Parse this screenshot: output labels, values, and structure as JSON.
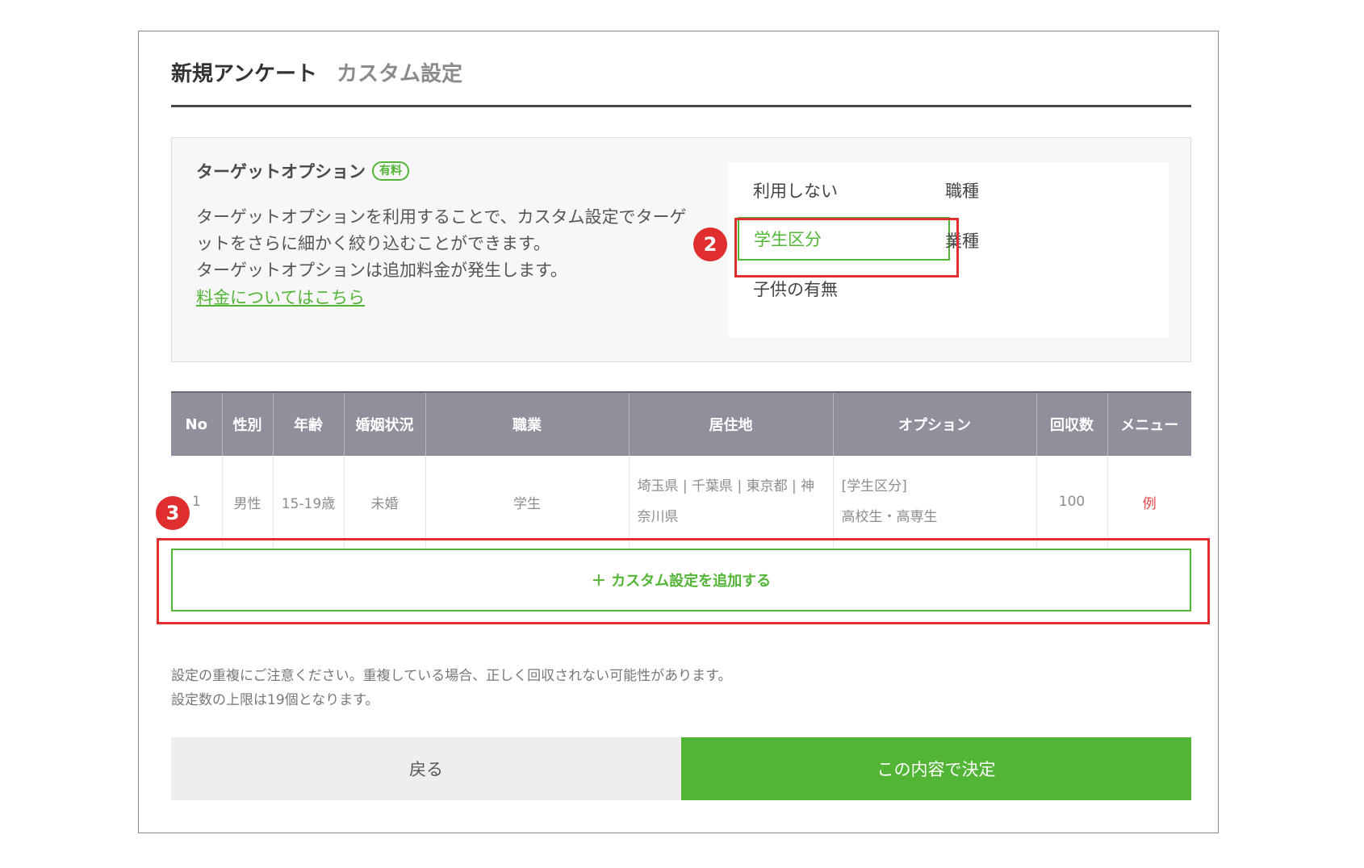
{
  "header": {
    "title": "新規アンケート",
    "subtitle": "カスタム設定"
  },
  "target_option": {
    "title": "ターゲットオプション",
    "badge": "有料",
    "desc_line1": "ターゲットオプションを利用することで、カスタム設定でターゲ",
    "desc_line2": "ットをさらに細かく絞り込むことができます。",
    "desc_line3": "ターゲットオプションは追加料金が発生します。",
    "link": "料金についてはこちら",
    "choices": [
      "利用しない",
      "学生区分",
      "子供の有無",
      "職種",
      "業種"
    ],
    "selected": "学生区分"
  },
  "callouts": {
    "step2": "2",
    "step3": "3"
  },
  "table": {
    "headers": [
      "No",
      "性別",
      "年齢",
      "婚姻状況",
      "職業",
      "居住地",
      "オプション",
      "回収数",
      "メニュー"
    ],
    "rows": [
      {
        "no": "1",
        "gender": "男性",
        "age": "15-19歳",
        "marital": "未婚",
        "job": "学生",
        "residence_line1": "埼玉県 | 千葉県 | 東京都 | 神",
        "residence_line2": "奈川県",
        "option_line1": "[学生区分]",
        "option_line2": "高校生・高専生",
        "count": "100",
        "menu": "例"
      }
    ]
  },
  "add_button": "＋ カスタム設定を追加する",
  "notes": {
    "line1": "設定の重複にご注意ください。重複している場合、正しく回収されない可能性があります。",
    "line2": "設定数の上限は19個となります。"
  },
  "buttons": {
    "back": "戻る",
    "submit": "この内容で決定"
  },
  "colors": {
    "accent": "#52b535",
    "callout": "#e02e2e",
    "table_header": "#8f909b"
  }
}
